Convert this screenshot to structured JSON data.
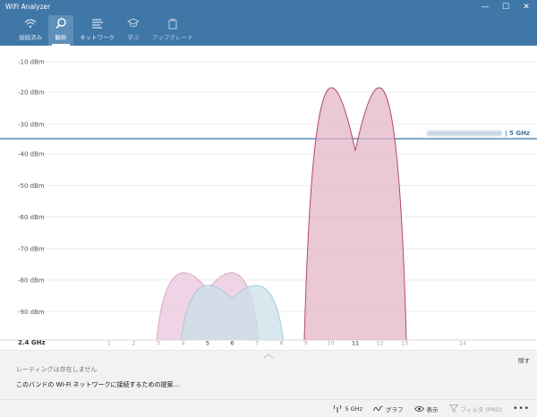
{
  "window": {
    "title": "WiFi Analyzer",
    "minimize": "—",
    "maximize": "☐",
    "close": "✕"
  },
  "nav": {
    "tabs": [
      {
        "label": "接続済み",
        "icon": "wifi-icon",
        "active": false
      },
      {
        "label": "解析",
        "icon": "search-icon",
        "active": true
      },
      {
        "label": "ネットワーク",
        "icon": "list-icon",
        "active": false
      },
      {
        "label": "学ぶ",
        "icon": "graduation-cap-icon",
        "active": false
      },
      {
        "label": "アップグレード",
        "icon": "upgrade-icon",
        "active": false
      }
    ]
  },
  "chart_data": {
    "type": "area",
    "top_panel": {
      "band": "5 GHz",
      "y_ticks": [
        "-10 dBm",
        "-20 dBm",
        "-30 dBm"
      ],
      "series": []
    },
    "bottom_panel": {
      "band": "2.4 GHz",
      "y_ticks": [
        "-40 dBm",
        "-50 dBm",
        "-60 dBm",
        "-70 dBm",
        "-80 dBm",
        "-90 dBm"
      ],
      "ylim": [
        -100,
        -35
      ],
      "x_ticks": [
        "1",
        "2",
        "3",
        "4",
        "5",
        "6",
        "7",
        "8",
        "9",
        "10",
        "11",
        "12",
        "13",
        "14"
      ],
      "highlighted_ticks": [
        "5",
        "6",
        "11"
      ],
      "series": [
        {
          "channel": 5,
          "peak_dbm": -83,
          "from_channel": 3,
          "to_channel": 7,
          "fill": "#e8c6dc",
          "stroke": "#d8a9c7"
        },
        {
          "channel": 6,
          "peak_dbm": -86,
          "from_channel": 4,
          "to_channel": 8,
          "fill": "#c9e0e8",
          "stroke": "#a8cad8"
        },
        {
          "channel": 11,
          "peak_dbm": -39,
          "from_channel": 9,
          "to_channel": 13,
          "fill": "#e3b6c8",
          "stroke": "#b5476f"
        }
      ]
    }
  },
  "band_label_5": "| 5 GHz",
  "band_label_24": "2.4 GHz",
  "info": {
    "hide": "隠す",
    "rating": "レーティングは存在しません",
    "suggestion": "このバンドの Wi-Fi ネットワークに接続するための提案…"
  },
  "commands": {
    "band": "5 GHz",
    "graph": "グラフ",
    "view": "表示",
    "filter": "フィルタ (PRO)",
    "more": "•••"
  },
  "colors": {
    "accent": "#3f77a7",
    "nav_active": "#5d8fbb"
  }
}
